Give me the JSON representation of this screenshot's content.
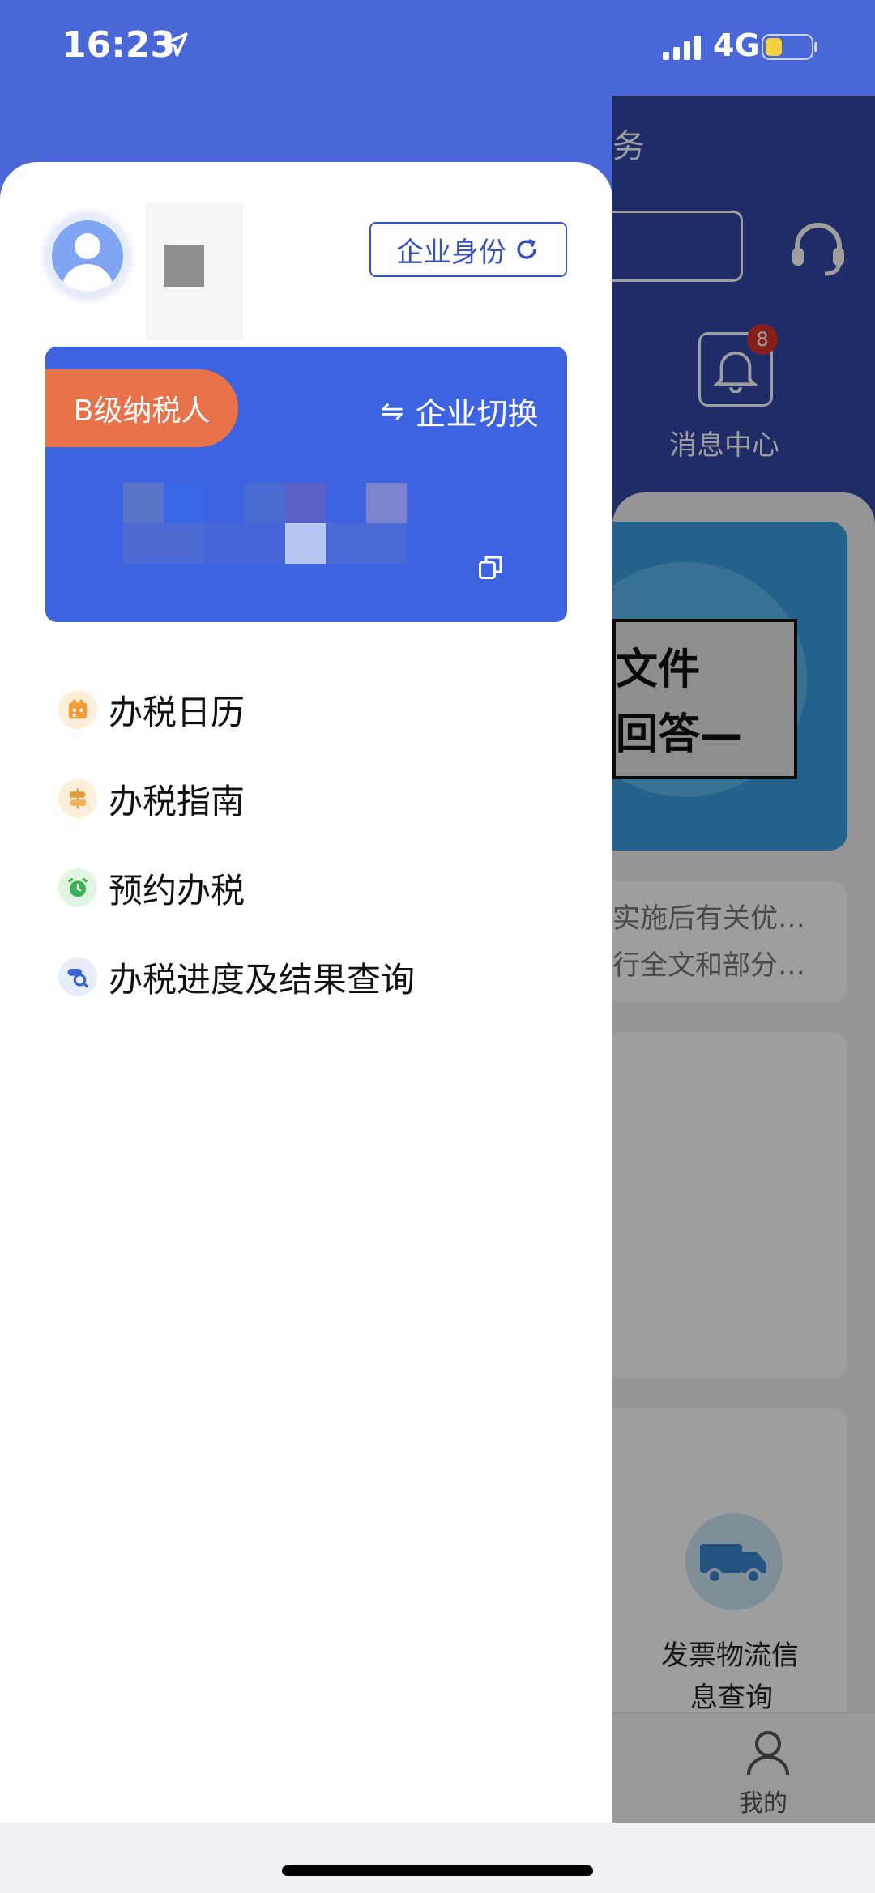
{
  "status_bar": {
    "time": "16:23",
    "network": "4G"
  },
  "drawer": {
    "identity_button": "企业身份",
    "taxpayer_level": "B级纳税人",
    "switch_label": "企业切换",
    "menu": [
      {
        "label": "办税日历",
        "icon": "calendar-icon"
      },
      {
        "label": "办税指南",
        "icon": "guide-icon"
      },
      {
        "label": "预约办税",
        "icon": "alarm-clock-icon"
      },
      {
        "label": "办税进度及结果查询",
        "icon": "progress-search-icon"
      }
    ]
  },
  "background": {
    "header_char": "务",
    "message_center": "消息中心",
    "message_badge": "8",
    "banner_line1": "文件",
    "banner_line2": "回答—",
    "news_line1": "实施后有关优…",
    "news_line2": "行全文和部分…",
    "invoice_logistics_line1": "发票物流信",
    "invoice_logistics_line2": "息查询",
    "tab_mine": "我的"
  },
  "colors": {
    "primary": "#4a67d8",
    "card_blue": "#3d63e0",
    "orange_badge": "#e8734a",
    "badge_red": "#d8332a",
    "text_dark": "#111111"
  }
}
